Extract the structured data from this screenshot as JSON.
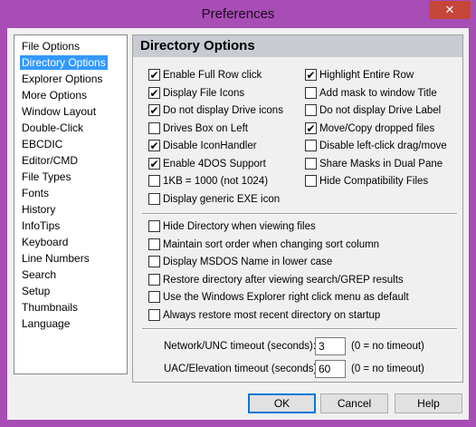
{
  "window": {
    "title": "Preferences",
    "close_glyph": "✕"
  },
  "nav": {
    "items": [
      "File Options",
      "Directory Options",
      "Explorer Options",
      "More Options",
      "Window Layout",
      "Double-Click",
      "EBCDIC",
      "Editor/CMD",
      "File Types",
      "Fonts",
      "History",
      "InfoTips",
      "Keyboard",
      "Line Numbers",
      "Search",
      "Setup",
      "Thumbnails",
      "Language"
    ],
    "selected": "Directory Options"
  },
  "panel": {
    "title": "Directory Options",
    "left_options": [
      {
        "label": "Enable Full Row click",
        "checked": true
      },
      {
        "label": "Display File Icons",
        "checked": true
      },
      {
        "label": "Do not display Drive icons",
        "checked": true
      },
      {
        "label": "Drives Box on Left",
        "checked": false
      },
      {
        "label": "Disable IconHandler",
        "checked": true
      },
      {
        "label": "Enable 4DOS Support",
        "checked": true
      },
      {
        "label": "1KB = 1000 (not 1024)",
        "checked": false
      },
      {
        "label": "Display generic EXE icon",
        "checked": false
      }
    ],
    "right_options": [
      {
        "label": "Highlight Entire Row",
        "checked": true
      },
      {
        "label": "Add mask to window Title",
        "checked": false
      },
      {
        "label": "Do not display Drive Label",
        "checked": false
      },
      {
        "label": "Move/Copy dropped files",
        "checked": true
      },
      {
        "label": "Disable left-click drag/move",
        "checked": false
      },
      {
        "label": "Share Masks in Dual Pane",
        "checked": false
      },
      {
        "label": "Hide Compatibility Files",
        "checked": false
      }
    ],
    "wide_options": [
      {
        "label": "Hide Directory when viewing files",
        "checked": false
      },
      {
        "label": "Maintain sort order when changing sort column",
        "checked": false
      },
      {
        "label": "Display MSDOS Name in lower case",
        "checked": false
      },
      {
        "label": "Restore directory after viewing search/GREP results",
        "checked": false
      },
      {
        "label": "Use the Windows Explorer right click menu as default",
        "checked": false
      },
      {
        "label": "Always restore most recent directory on startup",
        "checked": false
      }
    ],
    "network_timeout": {
      "label": "Network/UNC timeout (seconds):",
      "value": "3",
      "hint": "(0 = no timeout)"
    },
    "uac_timeout": {
      "label": "UAC/Elevation timeout (seconds):",
      "value": "60",
      "hint": "(0 = no timeout)"
    }
  },
  "buttons": {
    "ok": "OK",
    "cancel": "Cancel",
    "help": "Help"
  },
  "colors": {
    "frame": "#a74db5",
    "selection": "#3399ff",
    "header": "#c8cbd2",
    "close": "#c7463a"
  }
}
